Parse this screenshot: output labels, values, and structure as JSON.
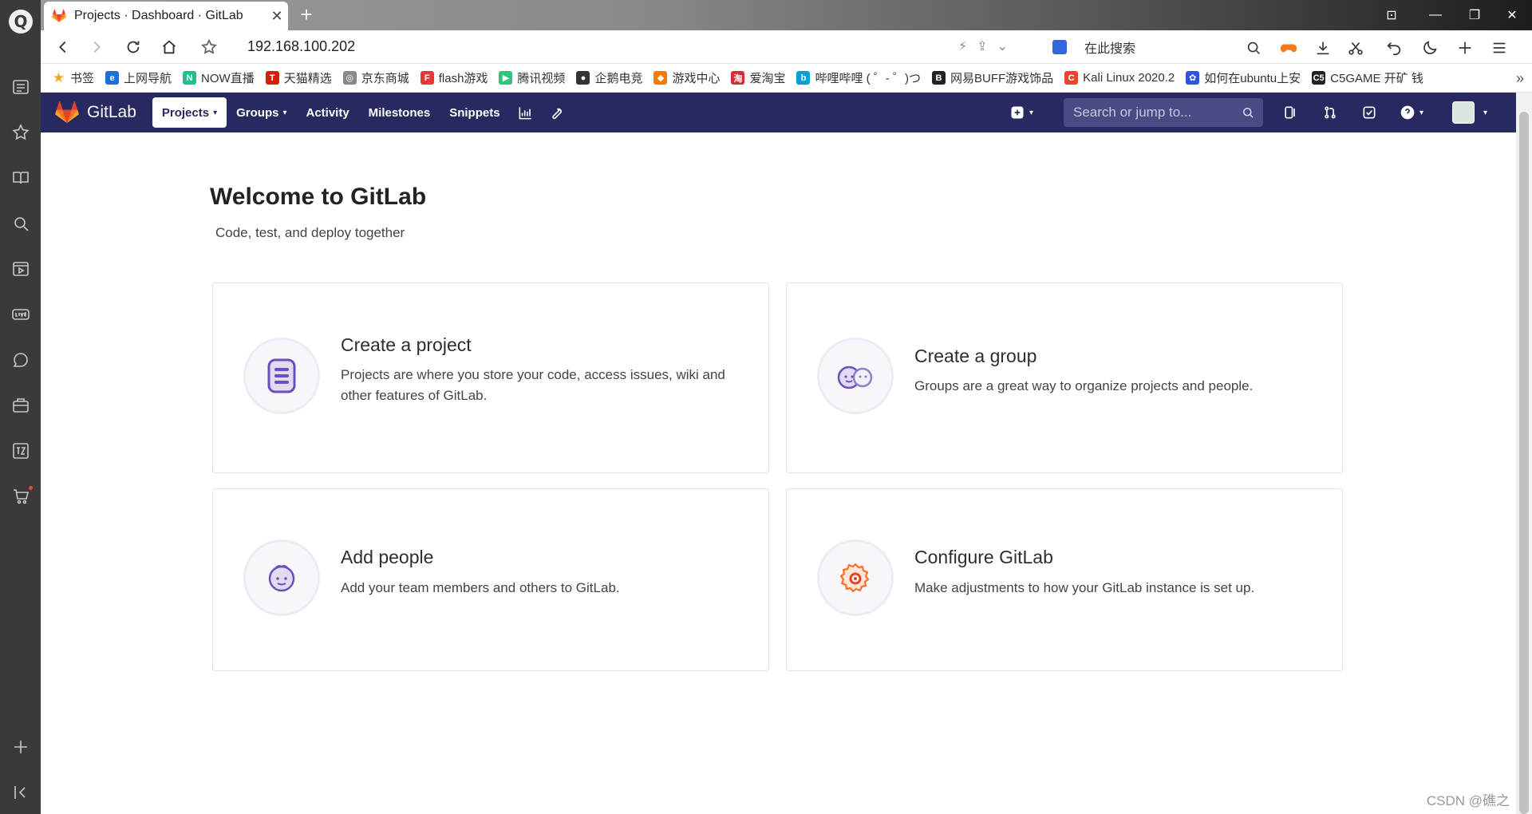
{
  "browser": {
    "tab_title": "Projects · Dashboard · GitLab",
    "tab_close": "✕",
    "new_tab": "+",
    "url": "192.168.100.202",
    "search_placeholder": "在此搜索",
    "win_controls": [
      "⊡",
      "—",
      "❐",
      "✕"
    ],
    "bookmarks": [
      {
        "label": "书签",
        "color": "#f5a623",
        "glyph": "★"
      },
      {
        "label": "上网导航",
        "color": "#1f6fd8",
        "glyph": "e"
      },
      {
        "label": "NOW直播",
        "color": "#1cc28f",
        "glyph": "N"
      },
      {
        "label": "天猫精选",
        "color": "#d81e06",
        "glyph": "T"
      },
      {
        "label": "京东商城",
        "color": "#888888",
        "glyph": "◎"
      },
      {
        "label": "flash游戏",
        "color": "#e53935",
        "glyph": "F"
      },
      {
        "label": "腾讯视频",
        "color": "#31c27c",
        "glyph": "▶"
      },
      {
        "label": "企鹅电竞",
        "color": "#333333",
        "glyph": "●"
      },
      {
        "label": "游戏中心",
        "color": "#f57c00",
        "glyph": "◆"
      },
      {
        "label": "爱淘宝",
        "color": "#d32f2f",
        "glyph": "淘"
      },
      {
        "label": "哔哩哔哩 ( ゜- ゜)つ",
        "color": "#00a1d6",
        "glyph": "b"
      },
      {
        "label": "网易BUFF游戏饰品",
        "color": "#222222",
        "glyph": "B"
      },
      {
        "label": "Kali Linux 2020.2",
        "color": "#e8452c",
        "glyph": "C"
      },
      {
        "label": "如何在ubuntu上安",
        "color": "#2d54dd",
        "glyph": "✿"
      },
      {
        "label": "C5GAME 开矿 钱",
        "color": "#222222",
        "glyph": "C5"
      }
    ],
    "bookmarks_more": "»"
  },
  "gitlab": {
    "brand": "GitLab",
    "nav": {
      "projects": "Projects",
      "groups": "Groups",
      "activity": "Activity",
      "milestones": "Milestones",
      "snippets": "Snippets"
    },
    "search_placeholder": "Search or jump to...",
    "chevron": "▾"
  },
  "welcome": {
    "title": "Welcome to GitLab",
    "subtitle": "Code, test, and deploy together"
  },
  "cards": {
    "create_project": {
      "title": "Create a project",
      "desc": "Projects are where you store your code, access issues, wiki and other features of GitLab."
    },
    "create_group": {
      "title": "Create a group",
      "desc": "Groups are a great way to organize projects and people."
    },
    "add_people": {
      "title": "Add people",
      "desc": "Add your team members and others to GitLab."
    },
    "configure": {
      "title": "Configure GitLab",
      "desc": "Make adjustments to how your GitLab instance is set up."
    }
  },
  "watermark": "CSDN @礁之"
}
